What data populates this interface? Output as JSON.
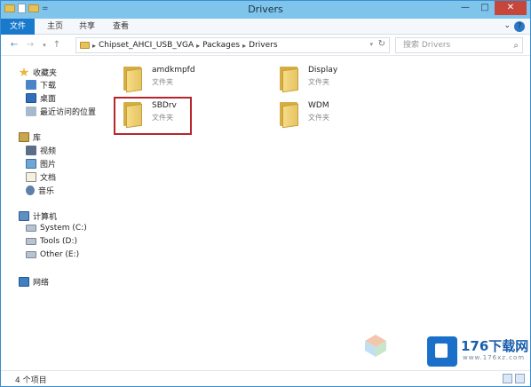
{
  "window": {
    "title": "Drivers"
  },
  "titlebar": {
    "quick_access_sep": "=",
    "minimize": "—",
    "maximize": "□",
    "close": "✕"
  },
  "ribbon": {
    "tabs": [
      "文件",
      "主页",
      "共享",
      "查看"
    ],
    "expand": "⌄",
    "help": "?"
  },
  "address": {
    "back": "←",
    "forward": "→",
    "history_dropdown": "▾",
    "up": "↑",
    "crumbs": [
      "Chipset_AHCI_USB_VGA",
      "Packages",
      "Drivers"
    ],
    "crumb_separator": "▸",
    "dropdown": "▾",
    "refresh": "↻"
  },
  "search": {
    "placeholder": "搜索 Drivers",
    "icon": "search-icon"
  },
  "navigation": {
    "favorites": {
      "label": "收藏夹",
      "items": [
        "下载",
        "桌面",
        "最近访问的位置"
      ]
    },
    "libraries": {
      "label": "库",
      "items": [
        "视频",
        "图片",
        "文档",
        "音乐"
      ]
    },
    "computer": {
      "label": "计算机",
      "items": [
        "System (C:)",
        "Tools (D:)",
        "Other (E:)"
      ]
    },
    "network": {
      "label": "网络"
    }
  },
  "files": [
    {
      "name": "amdkmpfd",
      "type": "文件夹"
    },
    {
      "name": "Display",
      "type": "文件夹"
    },
    {
      "name": "SBDrv",
      "type": "文件夹"
    },
    {
      "name": "WDM",
      "type": "文件夹"
    }
  ],
  "status": {
    "count": "4 个项目"
  },
  "watermark": {
    "text": "176下载网",
    "url": "www.176xz.com"
  }
}
